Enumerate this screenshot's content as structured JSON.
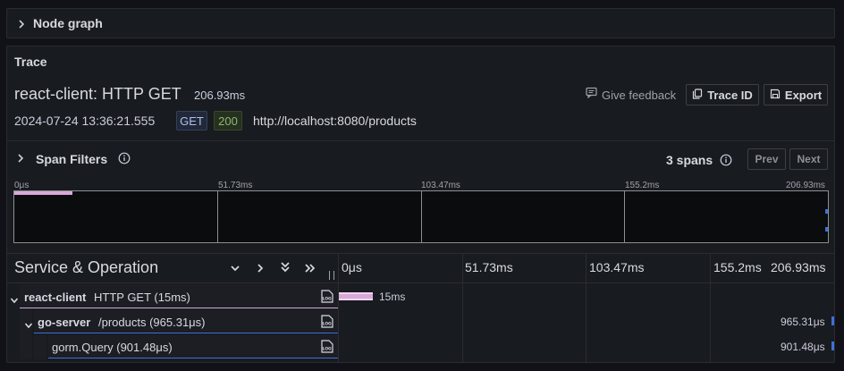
{
  "node_graph": {
    "label": "Node graph"
  },
  "trace_panel": {
    "title": "Trace",
    "trace_name": "react-client: HTTP GET",
    "duration": "206.93ms",
    "timestamp": "2024-07-24 13:36:21.555",
    "method": "GET",
    "status": "200",
    "url": "http://localhost:8080/products",
    "feedback_label": "Give feedback",
    "trace_id_label": "Trace ID",
    "export_label": "Export"
  },
  "span_filters": {
    "label": "Span Filters",
    "span_count": "3 spans",
    "prev_label": "Prev",
    "next_label": "Next"
  },
  "minimap": {
    "ticks": [
      "0μs",
      "51.73ms",
      "103.47ms",
      "155.2ms",
      "206.93ms"
    ]
  },
  "timeline": {
    "column_title": "Service & Operation",
    "ticks": [
      "0μs",
      "51.73ms",
      "103.47ms",
      "155.2ms",
      "206.93ms"
    ],
    "total_ms": 206.93,
    "spans": [
      {
        "service": "react-client",
        "operation": "HTTP GET (15ms)",
        "duration_label": "15ms",
        "start_ms": 0,
        "duration_ms": 15,
        "color": "#d8a8d8"
      },
      {
        "service": "go-server",
        "operation": "/products (965.31μs)",
        "duration_label": "965.31μs",
        "start_ms": 206.0,
        "duration_ms": 0.97,
        "color": "#3d71d9"
      },
      {
        "service": "",
        "operation": "gorm.Query (901.48μs)",
        "duration_label": "901.48μs",
        "start_ms": 206.0,
        "duration_ms": 0.9,
        "color": "#3d71d9"
      }
    ]
  },
  "colors": {
    "accent_pink": "#d8a8d8",
    "accent_blue": "#3d71d9",
    "status_green": "#8ab870"
  }
}
